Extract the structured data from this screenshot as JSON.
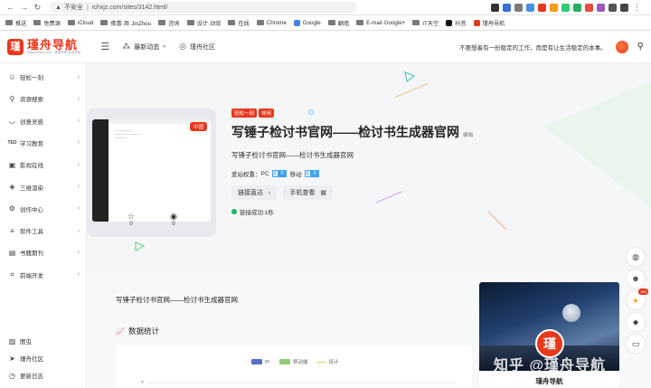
{
  "browser": {
    "security_label": "不安全",
    "url": "ichxjz.com/sites/3142.html/"
  },
  "bookmarks": [
    {
      "label": "推送",
      "kind": "folder"
    },
    {
      "label": "免费源",
      "kind": "folder"
    },
    {
      "label": "iCloud",
      "kind": "folder"
    },
    {
      "label": "佛喜·周·JinZhou",
      "kind": "folder"
    },
    {
      "label": "咨询",
      "kind": "folder"
    },
    {
      "label": "设计·动效",
      "kind": "folder"
    },
    {
      "label": "在线",
      "kind": "folder"
    },
    {
      "label": "Chrome",
      "kind": "folder"
    },
    {
      "label": "Google",
      "kind": "site"
    },
    {
      "label": "翻墙",
      "kind": "folder"
    },
    {
      "label": "E-mail·Google+",
      "kind": "folder"
    },
    {
      "label": "IT天空",
      "kind": "folder"
    },
    {
      "label": "抖音",
      "kind": "site"
    },
    {
      "label": "瑾舟导航",
      "kind": "site"
    }
  ],
  "header": {
    "logo_mark": "瑾",
    "logo_title": "瑾舟导航",
    "logo_sub": "www.jinzhou.com · 资源分享·技术导航",
    "nav": [
      {
        "label": "最新动态",
        "icon": "molecule-icon",
        "has_caret": true
      },
      {
        "label": "瑾舟社区",
        "icon": "globe-icon",
        "has_caret": false
      }
    ],
    "slogan": "不要想着有一份稳定的工作，而是有让生活稳定的本事。"
  },
  "sidebar": {
    "items": [
      {
        "label": "轻松一刻",
        "icon": "smile-icon"
      },
      {
        "label": "资源搜索",
        "icon": "search-icon"
      },
      {
        "label": "创意灵感",
        "icon": "idea-icon"
      },
      {
        "label": "学习教育",
        "icon": "ted-icon",
        "icon_text": "TED"
      },
      {
        "label": "影视在线",
        "icon": "film-icon"
      },
      {
        "label": "三维渲染",
        "icon": "cube-icon"
      },
      {
        "label": "创作中心",
        "icon": "gear-icon"
      },
      {
        "label": "软件工具",
        "icon": "sliders-icon"
      },
      {
        "label": "书籍期刊",
        "icon": "book-icon"
      },
      {
        "label": "前端开发",
        "icon": "code-icon"
      }
    ],
    "bottom": [
      {
        "label": "图虫",
        "icon": "image-icon"
      },
      {
        "label": "瑾舟社区",
        "icon": "telegram-icon"
      },
      {
        "label": "更新日志",
        "icon": "clock-icon"
      }
    ]
  },
  "site": {
    "tags": [
      "轻松一刻",
      "休闲"
    ],
    "region_tag": "中国",
    "title": "写锤子检讨书官网——检讨书生成器官网",
    "edit_label": "编辑",
    "subtitle": "写锤子检讨书官网——检讨书生成器官网",
    "weight_label": "爱站权重：",
    "pc_label": "PC",
    "pc_value": "0",
    "mobile_label": "移动",
    "mobile_value": "0",
    "visit_button": "链接直达",
    "mobile_button": "手机查看",
    "status": "链接成功:1秒",
    "star_count": "0",
    "view_count": "0",
    "desc": "写锤子检讨书官网——检讨书生成器官网"
  },
  "stats": {
    "title": "数据统计",
    "legend": [
      {
        "label": "pc",
        "color": "#5470c6"
      },
      {
        "label": "移动端",
        "color": "#91cc75"
      },
      {
        "label": "设计",
        "color": "#fac858"
      }
    ],
    "y_tick": "4"
  },
  "author": {
    "name": "瑾舟导航",
    "avatar_mark": "瑾"
  },
  "watermark": "知乎 @瑾舟导航",
  "float_buttons": [
    {
      "icon": "wechat-icon"
    },
    {
      "icon": "qq-icon"
    },
    {
      "icon": "hot-icon",
      "badge": "360"
    },
    {
      "icon": "tag-icon"
    },
    {
      "icon": "chat-icon"
    },
    {
      "icon": "up-icon"
    }
  ],
  "colors": {
    "brand": "#e8381b",
    "accent": "#3ea1ef",
    "success": "#1fb46e"
  }
}
